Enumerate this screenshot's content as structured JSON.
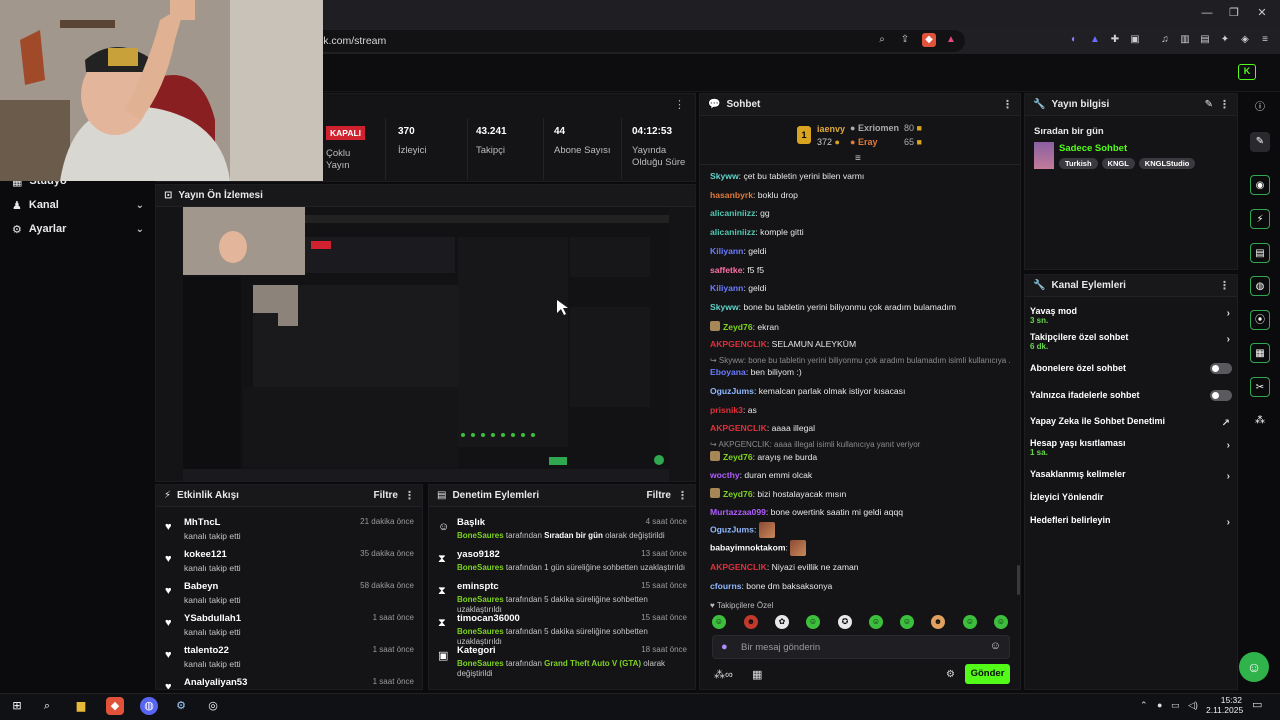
{
  "window": {
    "url": "ck.com/stream",
    "minimize": "—",
    "restore": "❐",
    "close": "✕"
  },
  "sidebar": {
    "items": [
      {
        "label": "Stüdyo"
      },
      {
        "label": "Kanal"
      },
      {
        "label": "Ayarlar"
      }
    ]
  },
  "stats": [
    {
      "value": "KAPALI",
      "label": "Çoklu Yayın"
    },
    {
      "value": "370",
      "label": "İzleyici"
    },
    {
      "value": "43.241",
      "label": "Takipçi"
    },
    {
      "value": "44",
      "label": "Abone Sayısı"
    },
    {
      "value": "04:12:53",
      "label": "Yayında Olduğu Süre"
    }
  ],
  "preview": {
    "title": "Yayın Ön İzlemesi"
  },
  "activity": {
    "title": "Etkinlik Akışı",
    "filter": "Filtre",
    "rows": [
      {
        "name": "MhTncL",
        "sub": "kanalı takip etti",
        "time": "21 dakika önce"
      },
      {
        "name": "kokee121",
        "sub": "kanalı takip etti",
        "time": "35 dakika önce"
      },
      {
        "name": "Babeyn",
        "sub": "kanalı takip etti",
        "time": "58 dakika önce"
      },
      {
        "name": "YSabdullah1",
        "sub": "kanalı takip etti",
        "time": "1 saat önce"
      },
      {
        "name": "ttalento22",
        "sub": "kanalı takip etti",
        "time": "1 saat önce"
      },
      {
        "name": "Analyaliyan53",
        "sub": "",
        "time": "1 saat önce"
      }
    ]
  },
  "moderation": {
    "title": "Denetim Eylemleri",
    "filter": "Filtre",
    "rows": [
      {
        "name": "Başlık",
        "actor": "BoneSaures",
        "mid": " tarafından ",
        "obj": "Sıradan bir gün",
        "tail": " olarak değiştirildi",
        "time": "4 saat önce"
      },
      {
        "name": "yaso9182",
        "actor": "BoneSaures",
        "mid": " tarafından 1 gün süreliğine sohbetten uzaklaştırıldı",
        "obj": "",
        "tail": "",
        "time": "13 saat önce"
      },
      {
        "name": "eminsptc",
        "actor": "BoneSaures",
        "mid": " tarafından 5 dakika süreliğine sohbetten uzaklaştırıldı",
        "obj": "",
        "tail": "",
        "time": "15 saat önce"
      },
      {
        "name": "timocan36000",
        "actor": "BoneSaures",
        "mid": " tarafından 5 dakika süreliğine sohbetten uzaklaştırıldı",
        "obj": "",
        "tail": "",
        "time": "15 saat önce"
      },
      {
        "name": "Kategori",
        "actor": "BoneSaures",
        "mid": " tarafından ",
        "obj": "Grand Theft Auto V (GTA)",
        "tail": " olarak değiştirildi",
        "time": "18 saat önce"
      }
    ]
  },
  "chat": {
    "title": "Sohbet",
    "top": [
      {
        "rank": "1",
        "name": "iaenvy",
        "count": "372"
      },
      {
        "name": "Exriomen",
        "count": "80"
      },
      {
        "name": "Eray",
        "count": "65"
      }
    ],
    "messages": [
      {
        "user": "Skyww",
        "color": "#5fd3c8",
        "text": "çet bu tabletin yerini bilen varmı"
      },
      {
        "user": "hasanbyrk",
        "color": "#e07b3a",
        "text": "boklu drop"
      },
      {
        "user": "alicaniniizz",
        "color": "#4ec9b0",
        "text": "gg"
      },
      {
        "user": "alicaniniizz",
        "color": "#4ec9b0",
        "text": "komple gitti"
      },
      {
        "user": "Kiliyann",
        "color": "#6b7bff",
        "text": "geldi"
      },
      {
        "user": "saffetke",
        "color": "#ff6fa8",
        "text": "f5 f5"
      },
      {
        "user": "Kiliyann",
        "color": "#6b7bff",
        "text": "geldi"
      },
      {
        "user": "Skyww",
        "color": "#5fd3c8",
        "text": "bone bu tabletin yerini biliyonmu çok aradım bulamadım"
      },
      {
        "user": "Zeyd76",
        "color": "#7ed321",
        "text": "ekran"
      },
      {
        "user": "AKPGENCLIK",
        "color": "#e0303a",
        "text": "SELAMUN ALEYKÜM"
      },
      {
        "user": "Eboyana",
        "color": "#6b7bff",
        "text": "ben biliyom :)"
      },
      {
        "user": "OguzJums",
        "color": "#8fb8ff",
        "text": "kemalcan parlak olmak istiyor kısacası"
      },
      {
        "user": "prisnik3",
        "color": "#e0303a",
        "text": "as"
      },
      {
        "user": "AKPGENCLIK",
        "color": "#e0303a",
        "text": "aaaa illegal"
      },
      {
        "user": "Zeyd76",
        "color": "#7ed321",
        "text": "arayış ne burda"
      },
      {
        "user": "wocthy",
        "color": "#b05cff",
        "text": "duran emmi olcak"
      },
      {
        "user": "Zeyd76",
        "color": "#7ed321",
        "text": "bizi hostalayacak mısın"
      },
      {
        "user": "Murtazzaa099",
        "color": "#b05cff",
        "text": "bone owertink saatin mi geldi aqqq"
      },
      {
        "user": "OguzJums",
        "color": "#8fb8ff",
        "text": ""
      },
      {
        "user": "babayimnoktakom",
        "color": "#ffffff",
        "text": ""
      },
      {
        "user": "AKPGENCLIK",
        "color": "#e0303a",
        "text": "Niyazi evillik ne zaman"
      },
      {
        "user": "cfourns",
        "color": "#8fb8ff",
        "text": "bone dm baksaksonya"
      }
    ],
    "replies": [
      {
        "text": "↪ Skyww: bone bu tabletin yerini biliyonmu çok aradım bulamadım isimli kullanıcıya ..."
      },
      {
        "text": "↪ AKPGENCLIK: aaaa illegal isimli kullanıcıya yanıt veriyor"
      }
    ],
    "followers_only": "Takipçilere Özel",
    "placeholder": "Bir mesaj gönderin",
    "send": "Gönder"
  },
  "info": {
    "title": "Yayın bilgisi",
    "stream_title": "Sıradan bir gün",
    "category": "Sadece Sohbet",
    "tags": [
      "Turkish",
      "KNGL",
      "KNGLStudio"
    ]
  },
  "actions": {
    "title": "Kanal Eylemleri",
    "items": [
      {
        "label": "Yavaş mod",
        "sub": "3 sn."
      },
      {
        "label": "Takipçilere özel sohbet",
        "sub": "6 dk."
      },
      {
        "label": "Abonelere özel sohbet",
        "sub": ""
      },
      {
        "label": "Yalnızca ifadelerle sohbet",
        "sub": ""
      },
      {
        "label": "Yapay Zeka ile Sohbet Denetimi",
        "sub": ""
      },
      {
        "label": "Hesap yaşı kısıtlaması",
        "sub": "1 sa."
      },
      {
        "label": "Yasaklanmış kelimeler",
        "sub": ""
      },
      {
        "label": "İzleyici Yönlendir",
        "sub": ""
      },
      {
        "label": "Hedefleri belirleyin",
        "sub": ""
      }
    ]
  },
  "taskbar": {
    "time": "15:32",
    "date": "2.11.2025"
  },
  "colors": {
    "accent": "#53fc18",
    "panel": "#141417",
    "danger": "#d0222e"
  }
}
